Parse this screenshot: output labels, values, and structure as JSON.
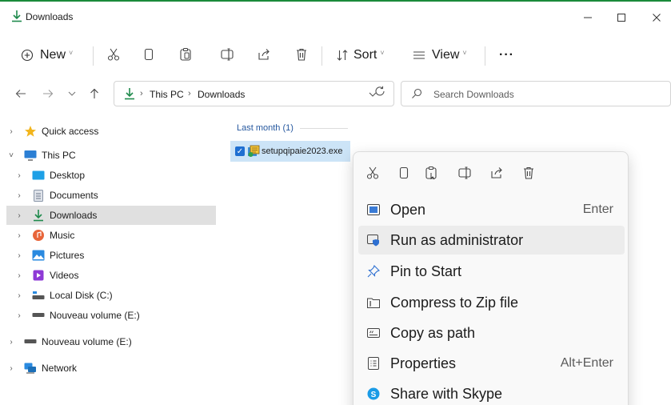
{
  "window": {
    "title": "Downloads"
  },
  "toolbar": {
    "new_label": "New",
    "sort_label": "Sort",
    "view_label": "View",
    "more_label": "···",
    "dropdown_glyph": "˅"
  },
  "address": {
    "crumbs": [
      "This PC",
      "Downloads"
    ],
    "separator": "›",
    "search_placeholder": "Search Downloads"
  },
  "sidebar": {
    "items": [
      {
        "label": "Quick access",
        "icon": "star-icon"
      },
      {
        "label": "This PC",
        "icon": "monitor-icon"
      },
      {
        "label": "Desktop",
        "icon": "desktop-icon"
      },
      {
        "label": "Documents",
        "icon": "documents-icon"
      },
      {
        "label": "Downloads",
        "icon": "downloads-icon"
      },
      {
        "label": "Music",
        "icon": "music-icon"
      },
      {
        "label": "Pictures",
        "icon": "pictures-icon"
      },
      {
        "label": "Videos",
        "icon": "videos-icon"
      },
      {
        "label": "Local Disk (C:)",
        "icon": "drive-icon"
      },
      {
        "label": "Nouveau volume (E:)",
        "icon": "drive-icon"
      },
      {
        "label": "Nouveau volume (E:)",
        "icon": "drive-icon"
      },
      {
        "label": "Network",
        "icon": "network-icon"
      }
    ]
  },
  "content": {
    "group_label": "Last month (1)",
    "file_name": "setupqipaie2023.exe"
  },
  "context_menu": {
    "items": [
      {
        "label": "Open",
        "shortcut": "Enter",
        "icon": "open-icon"
      },
      {
        "label": "Run as administrator",
        "shortcut": "",
        "icon": "shield-icon"
      },
      {
        "label": "Pin to Start",
        "shortcut": "",
        "icon": "pin-icon"
      },
      {
        "label": "Compress to Zip file",
        "shortcut": "",
        "icon": "zip-icon"
      },
      {
        "label": "Copy as path",
        "shortcut": "",
        "icon": "copy-path-icon"
      },
      {
        "label": "Properties",
        "shortcut": "Alt+Enter",
        "icon": "properties-icon"
      },
      {
        "label": "Share with Skype",
        "shortcut": "",
        "icon": "skype-icon"
      }
    ]
  },
  "colors": {
    "accent": "#0067c0",
    "download_green": "#1f8a4c",
    "selection": "#cce4f7",
    "sidebar_selected": "#e0e0e0"
  }
}
